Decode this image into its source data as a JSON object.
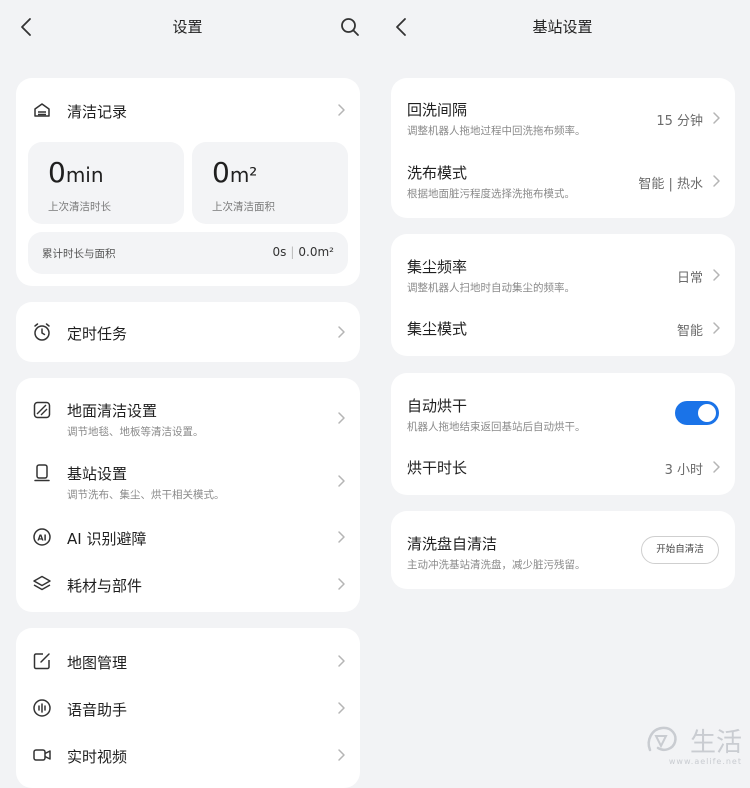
{
  "left": {
    "title": "设置",
    "record": {
      "label": "清洁记录",
      "duration_value": "0",
      "duration_unit": "min",
      "duration_caption": "上次清洁时长",
      "area_value": "0",
      "area_unit": "m²",
      "area_caption": "上次清洁面积",
      "total_label": "累计时长与面积",
      "total_time": "0s",
      "total_area": "0.0m²"
    },
    "timer": {
      "label": "定时任务"
    },
    "group2": [
      {
        "label": "地面清洁设置",
        "sub": "调节地毯、地板等清洁设置。"
      },
      {
        "label": "基站设置",
        "sub": "调节洗布、集尘、烘干相关模式。"
      },
      {
        "label": "AI 识别避障",
        "sub": ""
      },
      {
        "label": "耗材与部件",
        "sub": ""
      }
    ],
    "group3": [
      {
        "label": "地图管理"
      },
      {
        "label": "语音助手"
      },
      {
        "label": "实时视频"
      }
    ]
  },
  "right": {
    "title": "基站设置",
    "wash": [
      {
        "label": "回洗间隔",
        "sub": "调整机器人拖地过程中回洗拖布频率。",
        "value": "15 分钟"
      },
      {
        "label": "洗布模式",
        "sub": "根据地面脏污程度选择洗拖布模式。",
        "value": "智能 | 热水"
      }
    ],
    "dust": [
      {
        "label": "集尘频率",
        "sub": "调整机器人扫地时自动集尘的频率。",
        "value": "日常"
      },
      {
        "label": "集尘模式",
        "sub": "",
        "value": "智能"
      }
    ],
    "dry": {
      "auto_label": "自动烘干",
      "auto_sub": "机器人拖地结束返回基站后自动烘干。",
      "auto_on": true,
      "duration_label": "烘干时长",
      "duration_value": "3 小时"
    },
    "tray": {
      "label": "清洗盘自清洁",
      "sub": "主动冲洗基站清洗盘，减少脏污残留。",
      "button": "开始自清洁"
    }
  },
  "watermark": {
    "text": "生活",
    "url": "www.aelife.net"
  },
  "colors": {
    "accent": "#1a73e8",
    "background": "#f2f3f5",
    "card": "#ffffff"
  }
}
